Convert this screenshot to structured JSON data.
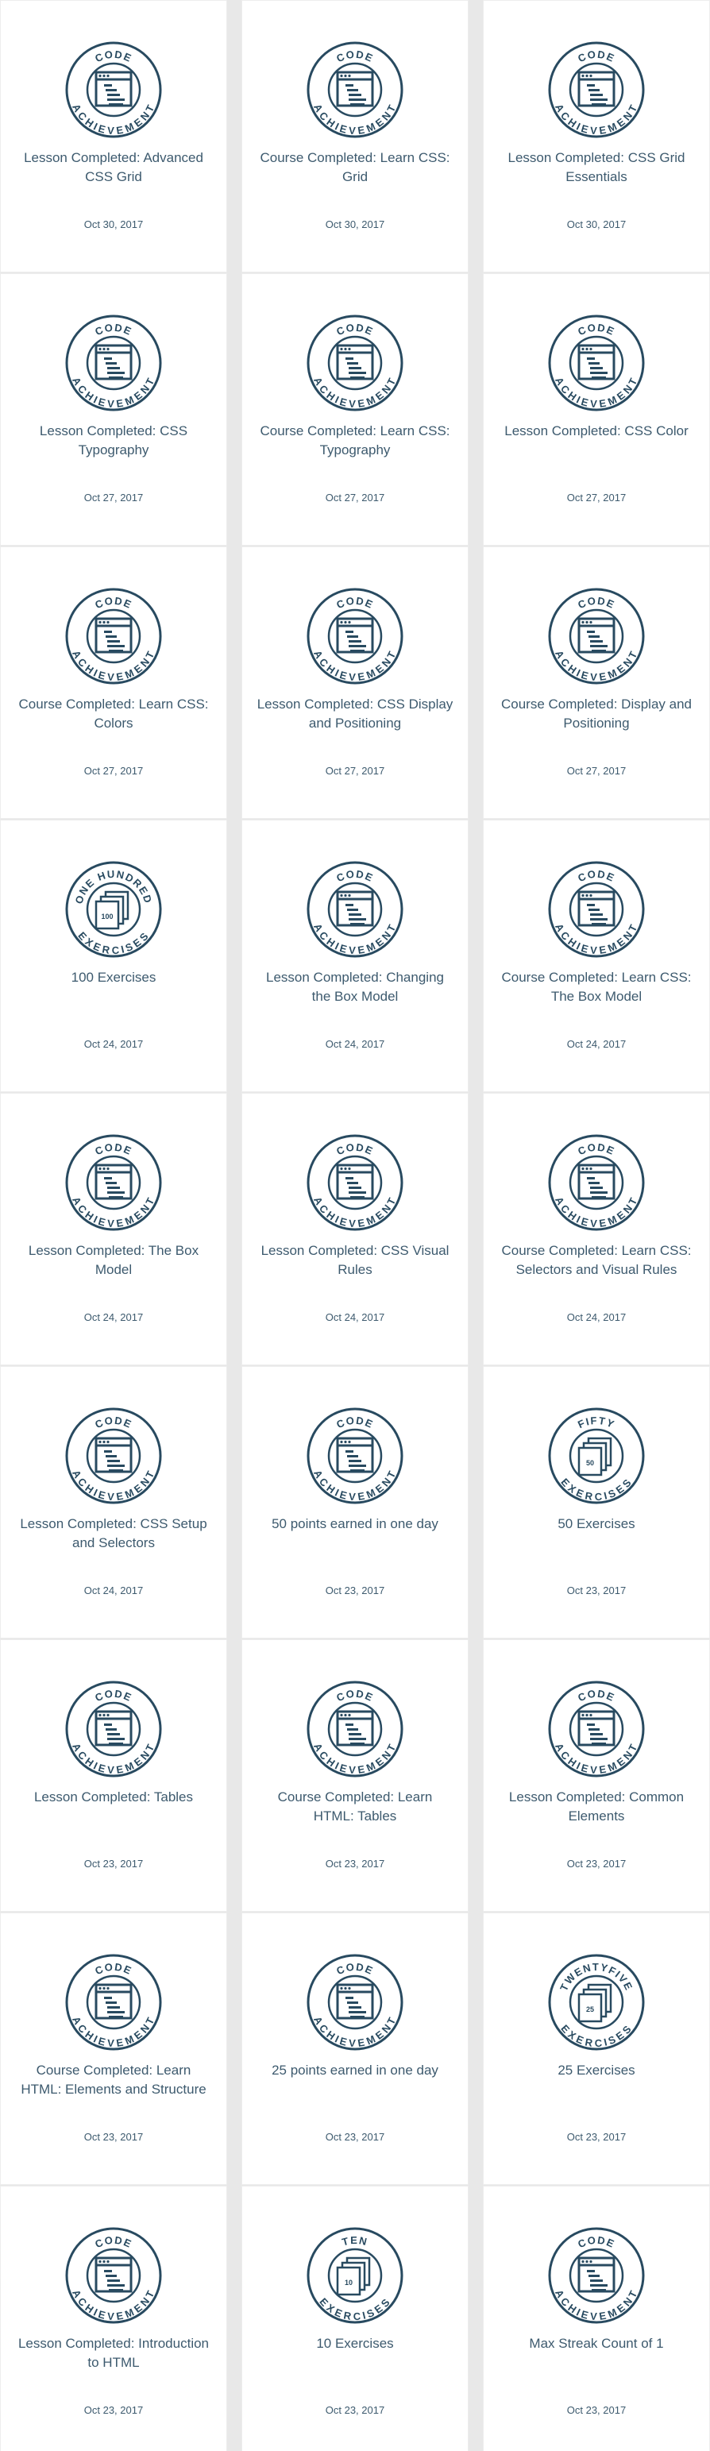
{
  "colors": {
    "badge": "#284a60",
    "text": "#3d5a6e",
    "background": "#e8e8e8",
    "card": "#ffffff"
  },
  "achievements": [
    {
      "title": "Lesson Completed: Advanced CSS Grid",
      "date": "Oct 30, 2017",
      "badge": {
        "icon": "code-window-icon",
        "top": "CODE",
        "bottom": "ACHIEVEMENT"
      }
    },
    {
      "title": "Course Completed: Learn CSS: Grid",
      "date": "Oct 30, 2017",
      "badge": {
        "icon": "code-window-icon",
        "top": "CODE",
        "bottom": "ACHIEVEMENT"
      }
    },
    {
      "title": "Lesson Completed: CSS Grid Essentials",
      "date": "Oct 30, 2017",
      "badge": {
        "icon": "code-window-icon",
        "top": "CODE",
        "bottom": "ACHIEVEMENT"
      }
    },
    {
      "title": "Lesson Completed: CSS Typography",
      "date": "Oct 27, 2017",
      "badge": {
        "icon": "code-window-icon",
        "top": "CODE",
        "bottom": "ACHIEVEMENT"
      }
    },
    {
      "title": "Course Completed: Learn CSS: Typography",
      "date": "Oct 27, 2017",
      "badge": {
        "icon": "code-window-icon",
        "top": "CODE",
        "bottom": "ACHIEVEMENT"
      }
    },
    {
      "title": "Lesson Completed: CSS Color",
      "date": "Oct 27, 2017",
      "badge": {
        "icon": "code-window-icon",
        "top": "CODE",
        "bottom": "ACHIEVEMENT"
      }
    },
    {
      "title": "Course Completed: Learn CSS: Colors",
      "date": "Oct 27, 2017",
      "badge": {
        "icon": "code-window-icon",
        "top": "CODE",
        "bottom": "ACHIEVEMENT"
      }
    },
    {
      "title": "Lesson Completed: CSS Display and Positioning",
      "date": "Oct 27, 2017",
      "badge": {
        "icon": "code-window-icon",
        "top": "CODE",
        "bottom": "ACHIEVEMENT"
      }
    },
    {
      "title": "Course Completed: Display and Positioning",
      "date": "Oct 27, 2017",
      "badge": {
        "icon": "code-window-icon",
        "top": "CODE",
        "bottom": "ACHIEVEMENT"
      }
    },
    {
      "title": "100 Exercises",
      "date": "Oct 24, 2017",
      "badge": {
        "icon": "exercise-stack-icon",
        "top": "ONE HUNDRED",
        "bottom": "EXERCISES",
        "number": "100"
      }
    },
    {
      "title": "Lesson Completed: Changing the Box Model",
      "date": "Oct 24, 2017",
      "badge": {
        "icon": "code-window-icon",
        "top": "CODE",
        "bottom": "ACHIEVEMENT"
      }
    },
    {
      "title": "Course Completed: Learn CSS: The Box Model",
      "date": "Oct 24, 2017",
      "badge": {
        "icon": "code-window-icon",
        "top": "CODE",
        "bottom": "ACHIEVEMENT"
      }
    },
    {
      "title": "Lesson Completed: The Box Model",
      "date": "Oct 24, 2017",
      "badge": {
        "icon": "code-window-icon",
        "top": "CODE",
        "bottom": "ACHIEVEMENT"
      }
    },
    {
      "title": "Lesson Completed: CSS Visual Rules",
      "date": "Oct 24, 2017",
      "badge": {
        "icon": "code-window-icon",
        "top": "CODE",
        "bottom": "ACHIEVEMENT"
      }
    },
    {
      "title": "Course Completed: Learn CSS: Selectors and Visual Rules",
      "date": "Oct 24, 2017",
      "badge": {
        "icon": "code-window-icon",
        "top": "CODE",
        "bottom": "ACHIEVEMENT"
      }
    },
    {
      "title": "Lesson Completed: CSS Setup and Selectors",
      "date": "Oct 24, 2017",
      "badge": {
        "icon": "code-window-icon",
        "top": "CODE",
        "bottom": "ACHIEVEMENT"
      }
    },
    {
      "title": "50 points earned in one day",
      "date": "Oct 23, 2017",
      "badge": {
        "icon": "code-window-icon",
        "top": "CODE",
        "bottom": "ACHIEVEMENT"
      }
    },
    {
      "title": "50 Exercises",
      "date": "Oct 23, 2017",
      "badge": {
        "icon": "exercise-stack-icon",
        "top": "FIFTY",
        "bottom": "EXERCISES",
        "number": "50"
      }
    },
    {
      "title": "Lesson Completed: Tables",
      "date": "Oct 23, 2017",
      "badge": {
        "icon": "code-window-icon",
        "top": "CODE",
        "bottom": "ACHIEVEMENT"
      }
    },
    {
      "title": "Course Completed: Learn HTML: Tables",
      "date": "Oct 23, 2017",
      "badge": {
        "icon": "code-window-icon",
        "top": "CODE",
        "bottom": "ACHIEVEMENT"
      }
    },
    {
      "title": "Lesson Completed: Common Elements",
      "date": "Oct 23, 2017",
      "badge": {
        "icon": "code-window-icon",
        "top": "CODE",
        "bottom": "ACHIEVEMENT"
      }
    },
    {
      "title": "Course Completed: Learn HTML: Elements and Structure",
      "date": "Oct 23, 2017",
      "badge": {
        "icon": "code-window-icon",
        "top": "CODE",
        "bottom": "ACHIEVEMENT"
      }
    },
    {
      "title": "25 points earned in one day",
      "date": "Oct 23, 2017",
      "badge": {
        "icon": "code-window-icon",
        "top": "CODE",
        "bottom": "ACHIEVEMENT"
      }
    },
    {
      "title": "25 Exercises",
      "date": "Oct 23, 2017",
      "badge": {
        "icon": "exercise-stack-icon",
        "top": "TWENTYFIVE",
        "bottom": "EXERCISES",
        "number": "25"
      }
    },
    {
      "title": "Lesson Completed: Introduction to HTML",
      "date": "Oct 23, 2017",
      "badge": {
        "icon": "code-window-icon",
        "top": "CODE",
        "bottom": "ACHIEVEMENT"
      }
    },
    {
      "title": "10 Exercises",
      "date": "Oct 23, 2017",
      "badge": {
        "icon": "exercise-stack-icon",
        "top": "TEN",
        "bottom": "EXERCISES",
        "number": "10"
      }
    },
    {
      "title": "Max Streak Count of 1",
      "date": "Oct 23, 2017",
      "badge": {
        "icon": "code-window-icon",
        "top": "CODE",
        "bottom": "ACHIEVEMENT"
      }
    }
  ]
}
